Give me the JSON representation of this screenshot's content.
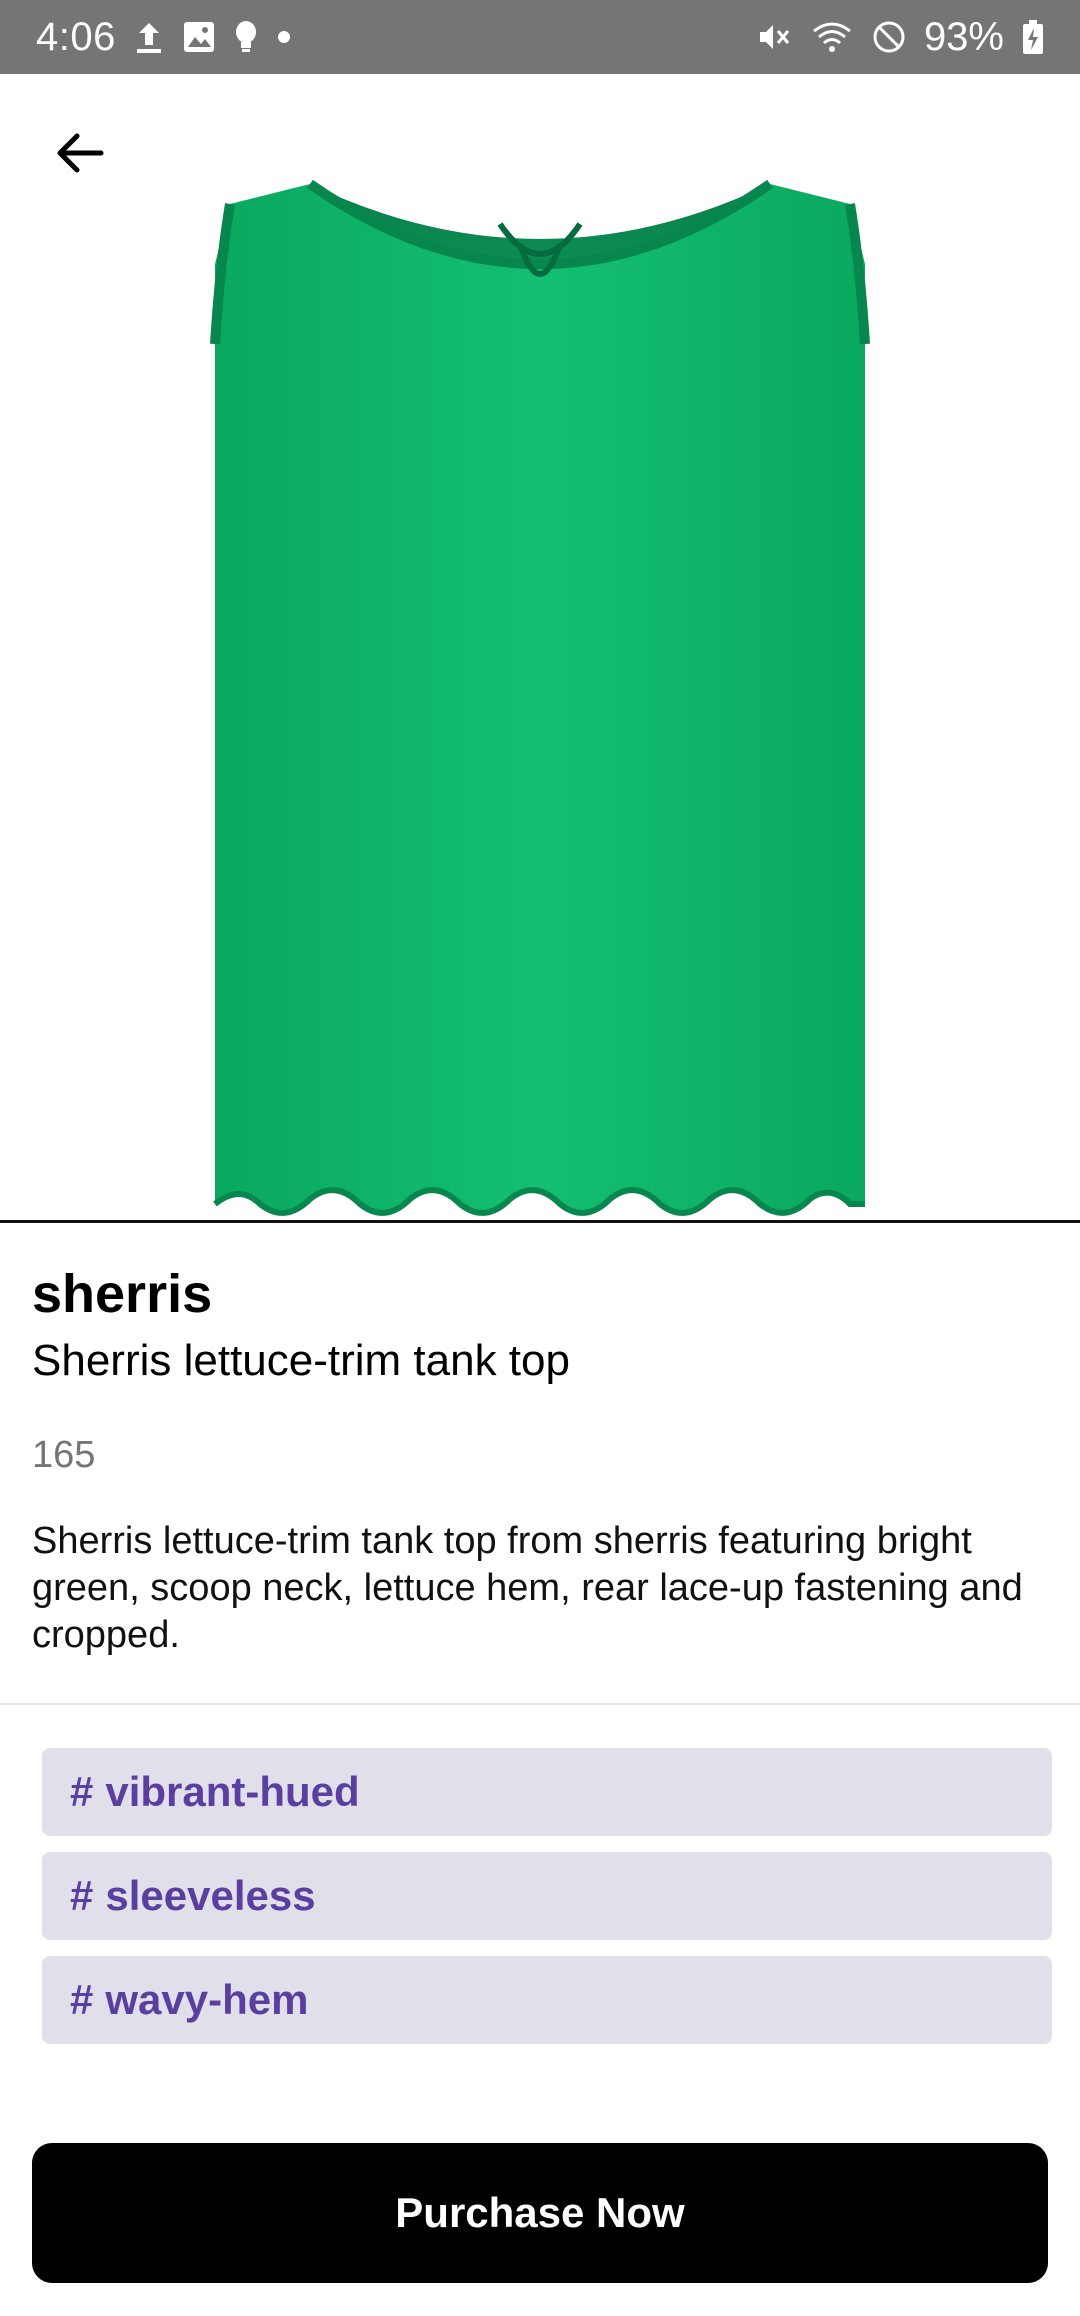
{
  "status_bar": {
    "time": "4:06",
    "battery_percent": "93%",
    "left_icons": [
      "upload-icon",
      "image-icon",
      "lightbulb-icon",
      "dot-icon"
    ],
    "right_icons": [
      "mute-icon",
      "wifi-icon",
      "do-not-disturb-icon",
      "battery-charging-icon"
    ]
  },
  "header": {
    "back_icon": "arrow-left-icon"
  },
  "product": {
    "image_description_icon": "tank-top-image",
    "color": "#10b86c",
    "brand": "sherris",
    "name": "Sherris lettuce-trim tank top",
    "price": "165",
    "description": "Sherris lettuce-trim tank top from sherris featuring bright green, scoop neck, lettuce hem, rear lace-up fastening and cropped."
  },
  "tags": [
    {
      "hash": "#",
      "label": "vibrant-hued"
    },
    {
      "hash": "#",
      "label": "sleeveless"
    },
    {
      "hash": "#",
      "label": "wavy-hem"
    }
  ],
  "actions": {
    "purchase_label": "Purchase Now"
  },
  "colors": {
    "status_bar": "#757575",
    "tag_bg": "#e1dfea",
    "tag_text": "#5b3fa0",
    "button_bg": "#000000"
  }
}
